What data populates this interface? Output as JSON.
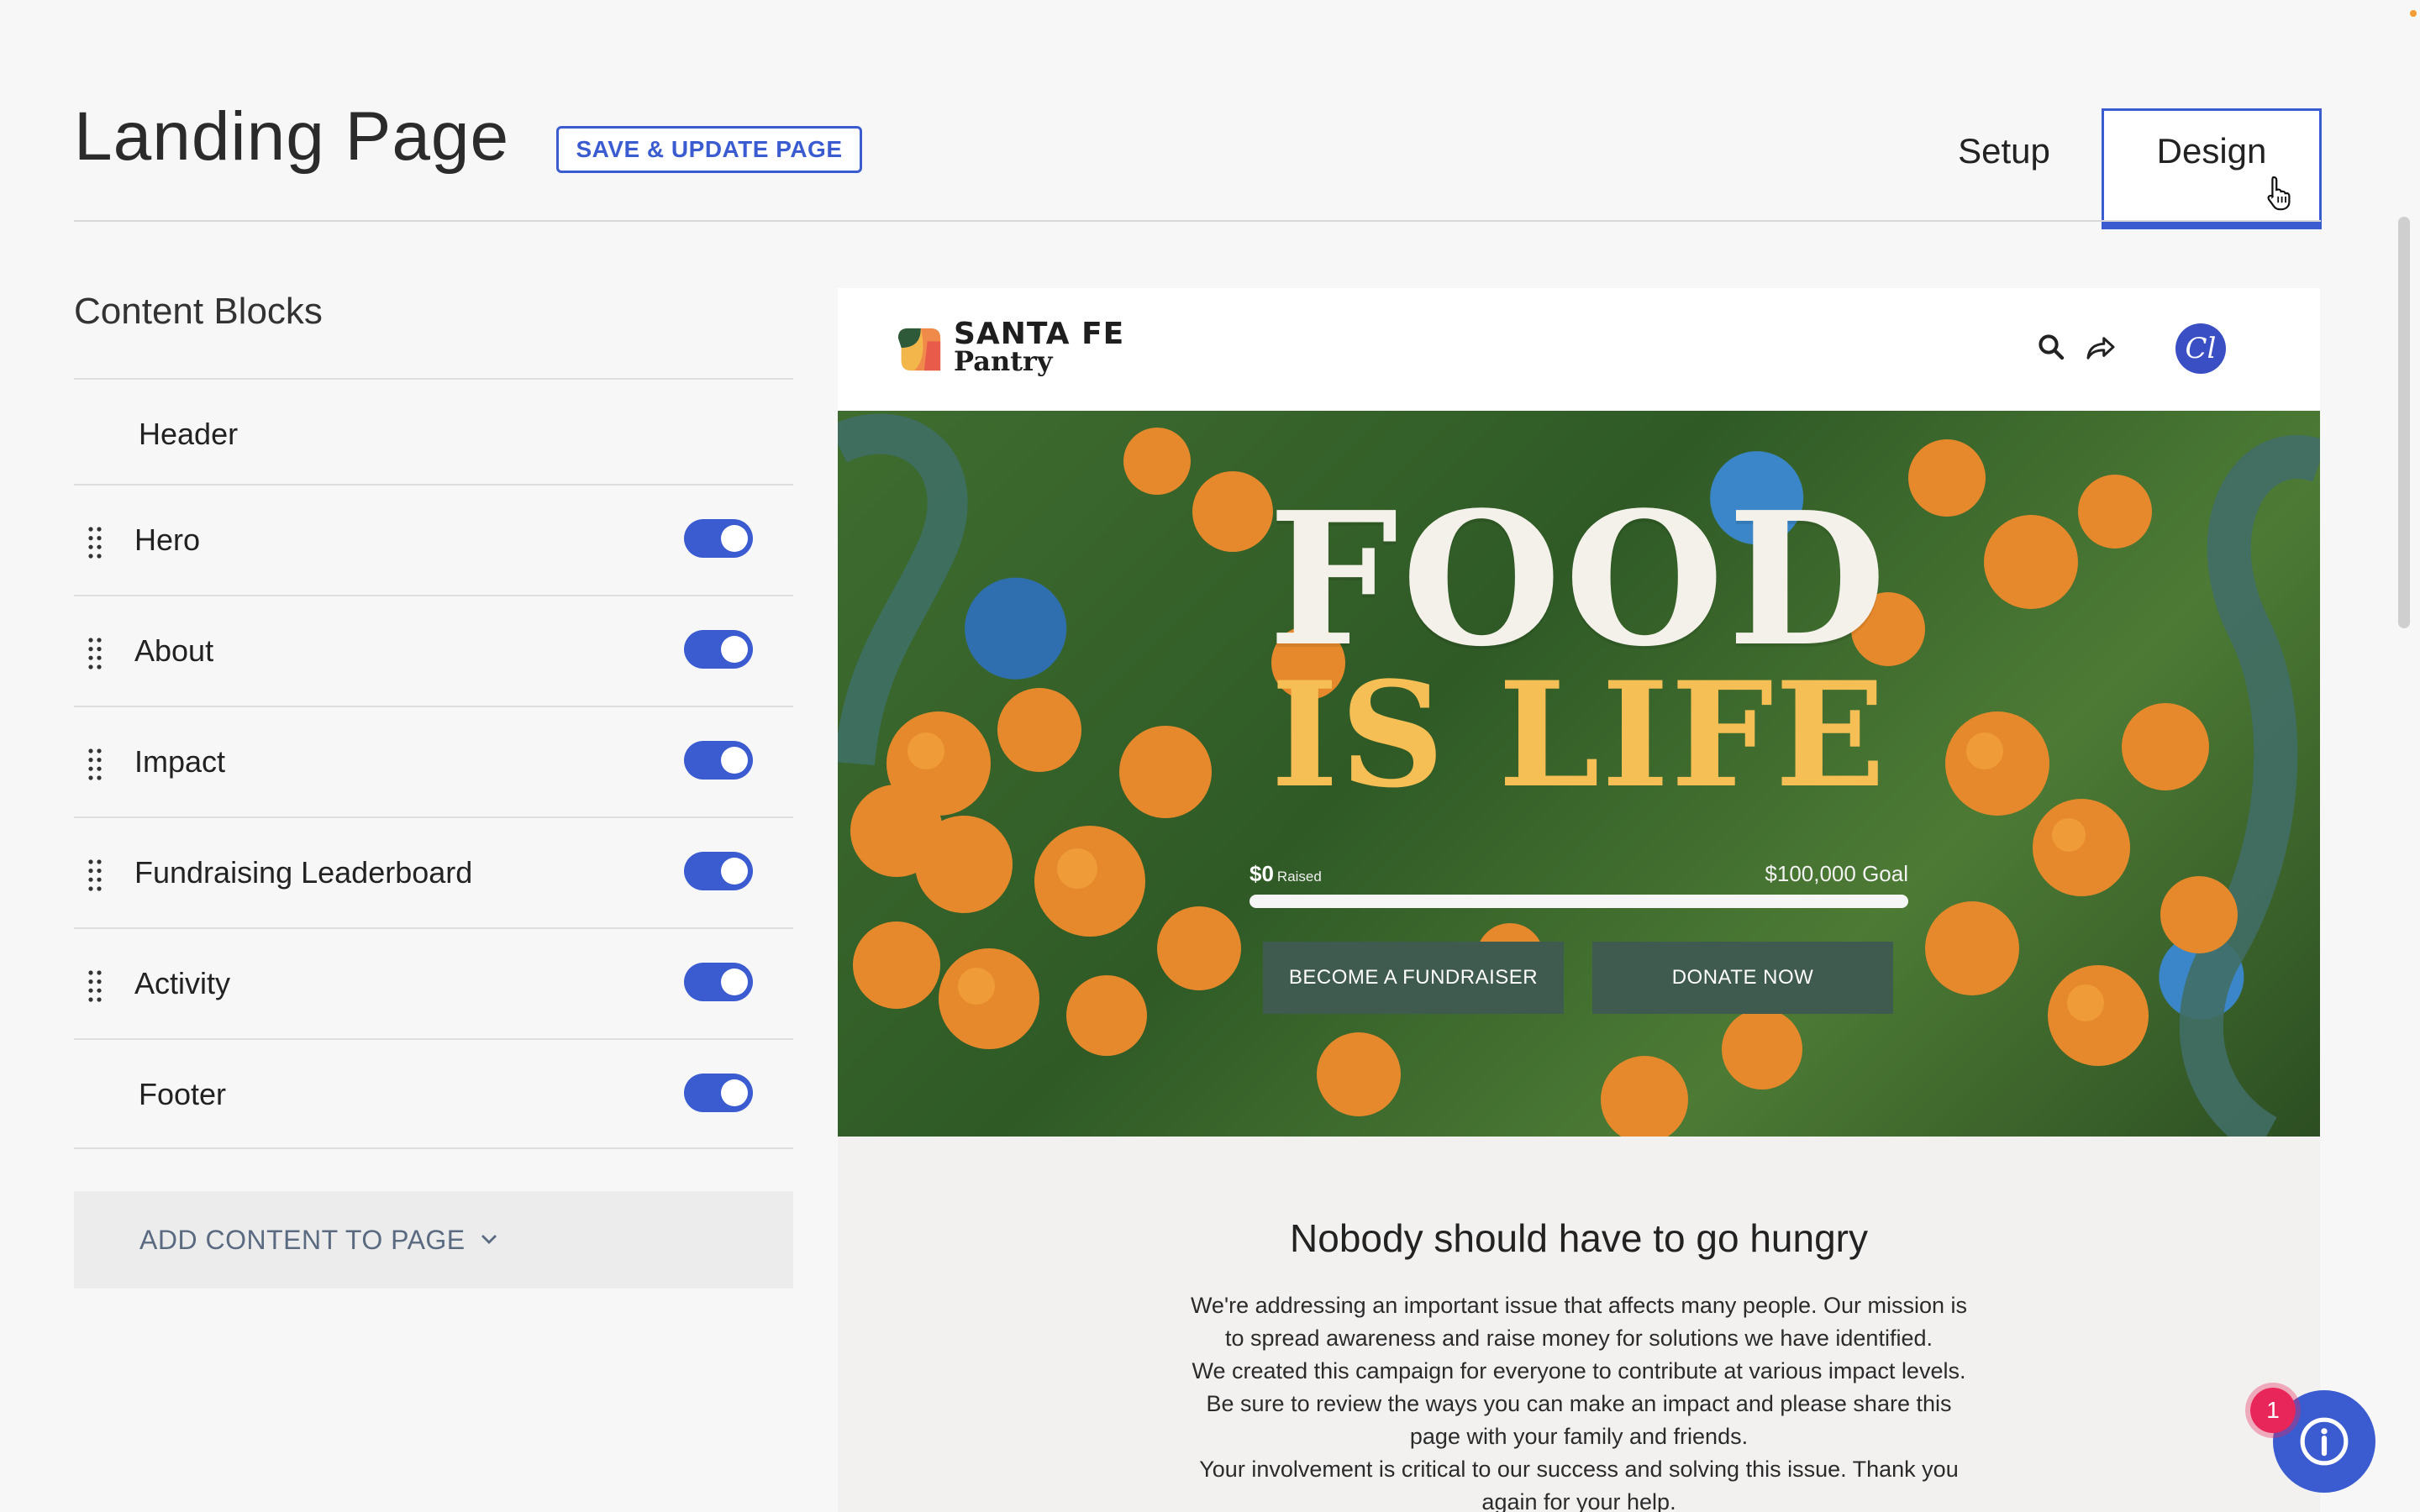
{
  "header": {
    "title": "Landing Page",
    "save_label": "SAVE & UPDATE PAGE",
    "tabs": [
      {
        "label": "Setup",
        "active": false
      },
      {
        "label": "Design",
        "active": true
      }
    ]
  },
  "sidebar": {
    "title": "Content Blocks",
    "blocks": [
      {
        "label": "Header",
        "draggable": false,
        "toggle": null
      },
      {
        "label": "Hero",
        "draggable": true,
        "toggle": true
      },
      {
        "label": "About",
        "draggable": true,
        "toggle": true
      },
      {
        "label": "Impact",
        "draggable": true,
        "toggle": true
      },
      {
        "label": "Fundraising Leaderboard",
        "draggable": true,
        "toggle": true
      },
      {
        "label": "Activity",
        "draggable": true,
        "toggle": true
      },
      {
        "label": "Footer",
        "draggable": false,
        "toggle": true
      }
    ],
    "add_content_label": "ADD CONTENT TO PAGE"
  },
  "preview": {
    "logo": {
      "line1": "SANTA FE",
      "line2": "Pantry"
    },
    "avatar_text": "Cl",
    "hero": {
      "headline_top": "FOOD",
      "headline_bottom": "IS LIFE",
      "raised_amount": "$0",
      "raised_label": "Raised",
      "goal_label": "$100,000 Goal",
      "progress_fraction": 0,
      "fundraiser_button": "BECOME A FUNDRAISER",
      "donate_button": "DONATE NOW"
    },
    "about": {
      "title": "Nobody should have to go hungry",
      "lines": [
        "We're addressing an important issue that affects many people. Our mission is",
        "to spread awareness and raise money for solutions we have identified.",
        "We created this campaign for everyone to contribute at various impact levels.",
        "Be sure to review the ways you can make an impact and please share this",
        "page with your family and friends.",
        "Your involvement is critical to our success and solving this issue. Thank you",
        "again for your help."
      ]
    }
  },
  "help": {
    "badge_count": "1"
  },
  "colors": {
    "accent": "#3b5bd0",
    "hero_button": "#3f5a4e",
    "headline_yellow": "#f6bf55",
    "badge": "#e8265a"
  }
}
